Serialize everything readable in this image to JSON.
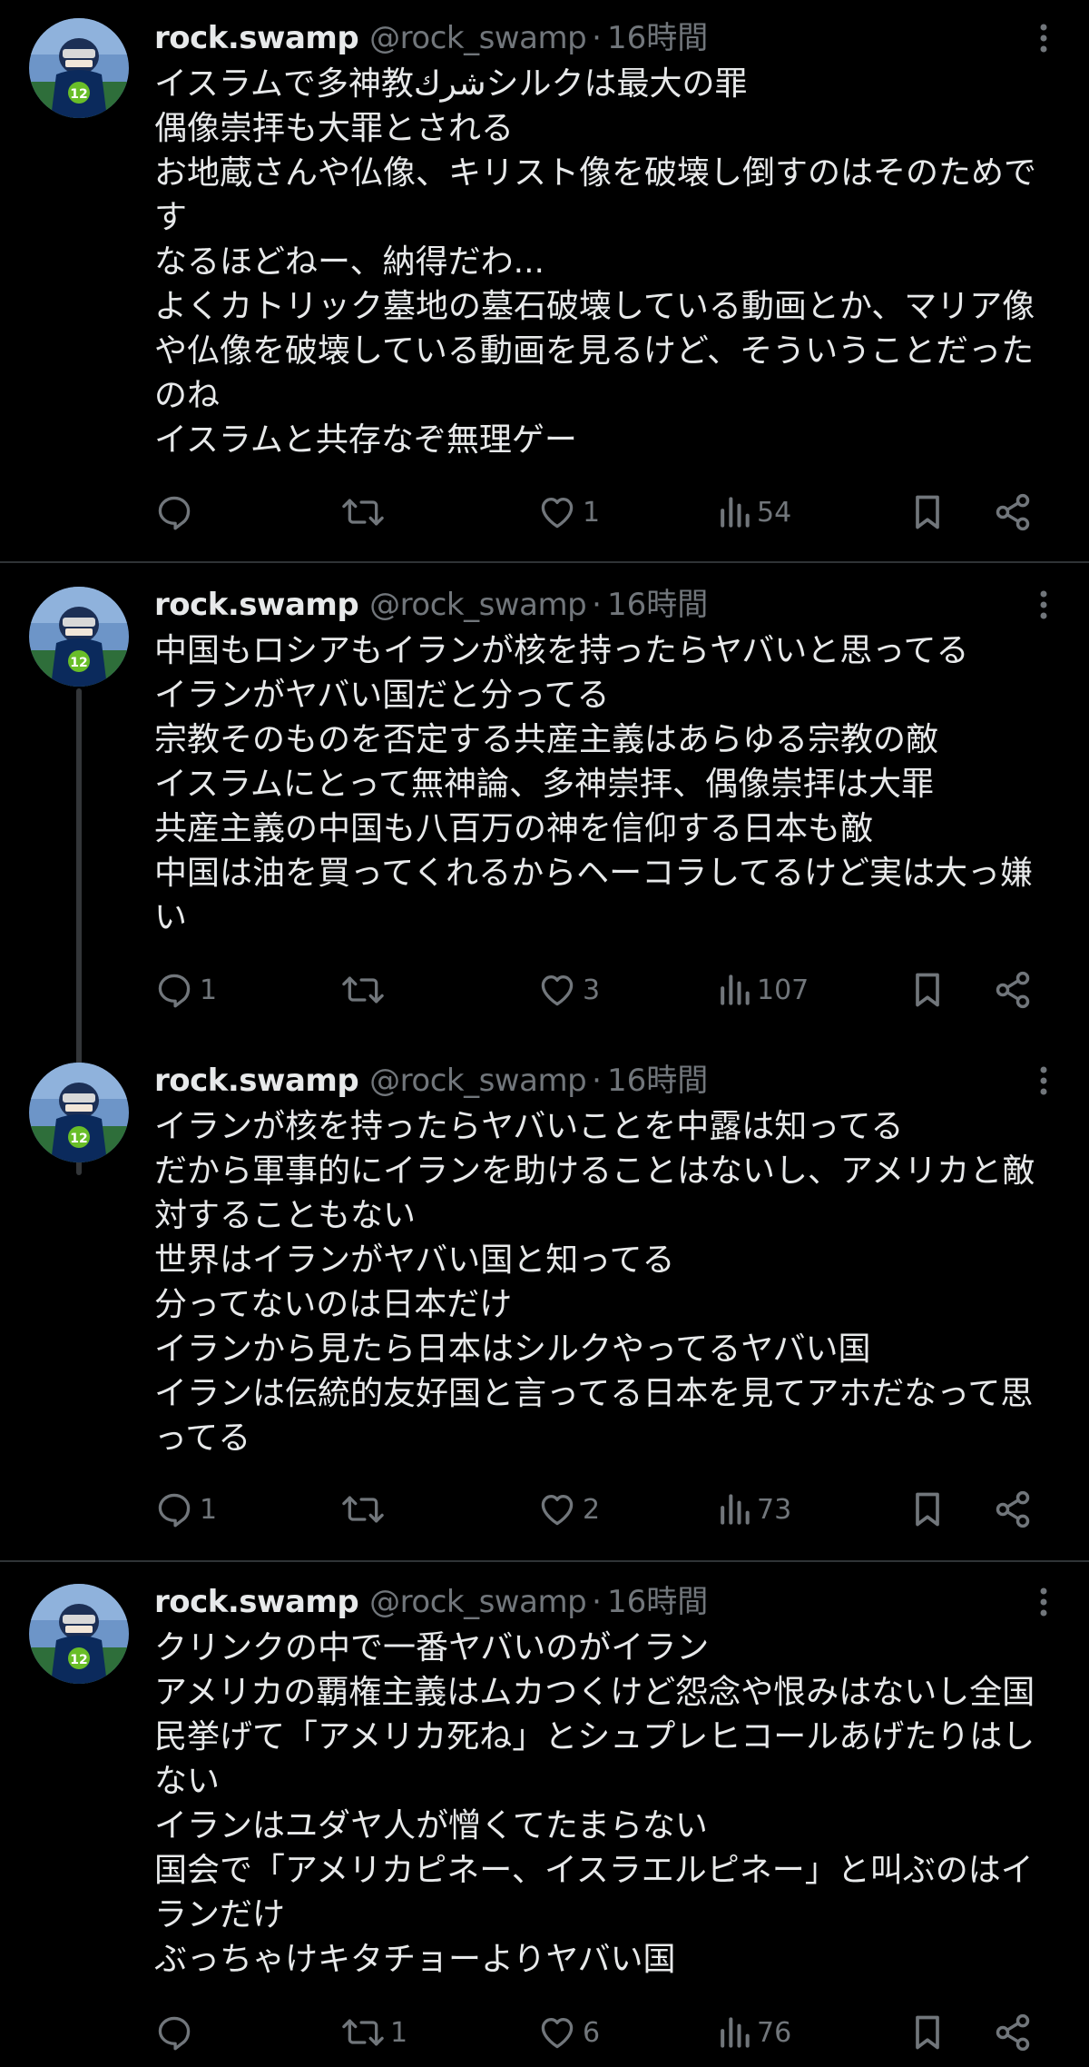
{
  "posts": [
    {
      "name": "rock.swamp",
      "handle": "@rock_swamp",
      "time": "16時間",
      "lines": [
        "イスラムで多神教شركシルクは最大の罪",
        "偶像崇拝も大罪とされる",
        "お地蔵さんや仏像、キリスト像を破壊し倒すのはそのためで",
        "す",
        "なるほどねー、納得だわ...",
        "よくカトリック墓地の墓石破壊している動画とか、マリア像",
        "や仏像を破壊している動画を見るけど、そういうことだった",
        "のね",
        "イスラムと共存なぞ無理ゲー"
      ],
      "counts": {
        "replies": "",
        "reposts": "",
        "likes": "1",
        "views": "54"
      }
    },
    {
      "name": "rock.swamp",
      "handle": "@rock_swamp",
      "time": "16時間",
      "lines": [
        "中国もロシアもイランが核を持ったらヤバいと思ってる",
        "イランがヤバい国だと分ってる",
        "宗教そのものを否定する共産主義はあらゆる宗教の敵",
        "イスラムにとって無神論、多神崇拝、偶像崇拝は大罪",
        "共産主義の中国も八百万の神を信仰する日本も敵",
        "中国は油を買ってくれるからヘーコラしてるけど実は大っ嫌",
        "い"
      ],
      "counts": {
        "replies": "1",
        "reposts": "",
        "likes": "3",
        "views": "107"
      }
    },
    {
      "name": "rock.swamp",
      "handle": "@rock_swamp",
      "time": "16時間",
      "lines": [
        "イランが核を持ったらヤバいことを中露は知ってる",
        "だから軍事的にイランを助けることはないし、アメリカと敵",
        "対することもない",
        "世界はイランがヤバい国と知ってる",
        "分ってないのは日本だけ",
        "イランから見たら日本はシルクやってるヤバい国",
        "イランは伝統的友好国と言ってる日本を見てアホだなって思",
        "ってる"
      ],
      "counts": {
        "replies": "1",
        "reposts": "",
        "likes": "2",
        "views": "73"
      }
    },
    {
      "name": "rock.swamp",
      "handle": "@rock_swamp",
      "time": "16時間",
      "lines": [
        "クリンクの中で一番ヤバいのがイラン",
        "アメリカの覇権主義はムカつくけど怨念や恨みはないし全国",
        "民挙げて「アメリカ死ね」とシュプレヒコールあげたりはし",
        "ない",
        "イランはユダヤ人が憎くてたまらない",
        "国会で「アメリカピネー、イスラエルピネー」と叫ぶのはイ",
        "ランだけ",
        "ぶっちゃけキタチョーよりヤバい国"
      ],
      "counts": {
        "replies": "",
        "reposts": "1",
        "likes": "6",
        "views": "76"
      }
    }
  ],
  "colors": {
    "background": "#000000",
    "text": "#e7e9ea",
    "muted": "#71767b",
    "divider": "#2f3336",
    "thread_line": "#333639",
    "avatar_bg": "#4a78b0",
    "jersey": "#0b2a5c",
    "accent": "#69be28"
  },
  "icons": {
    "reply": "reply-icon",
    "repost": "repost-icon",
    "like": "heart-icon",
    "views": "views-icon",
    "bookmark": "bookmark-icon",
    "share": "share-icon",
    "more": "more-icon"
  }
}
